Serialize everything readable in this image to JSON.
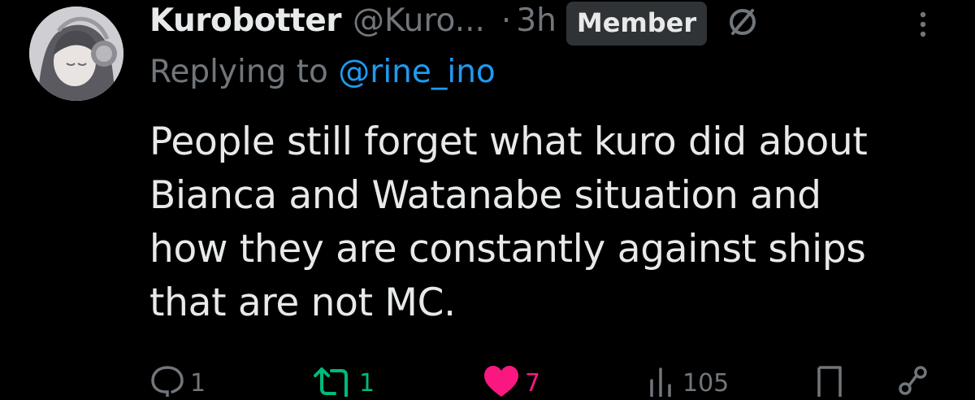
{
  "tweet": {
    "author": {
      "display_name": "Kurobotter",
      "handle": "@Kuro...",
      "avatar_icon": "avatar-anime-headphones"
    },
    "separator": "·",
    "time": "3h",
    "badge": "Member",
    "reply": {
      "prefix": "Replying to ",
      "mention": "@rine_ino"
    },
    "text_lines": [
      "People still forget what kuro did about",
      "Bianca and Watanabe situation and",
      "how they are constantly against ships",
      "that are not MC."
    ],
    "actions": {
      "replies": "1",
      "reposts": "1",
      "likes": "7",
      "views": "105"
    }
  },
  "colors": {
    "background": "#000000",
    "text": "#e7e9ea",
    "secondary": "#71767b",
    "link": "#1d9bf0",
    "repost_active": "#00ba7c",
    "like_active": "#f91880",
    "badge_bg": "#2f3336"
  }
}
